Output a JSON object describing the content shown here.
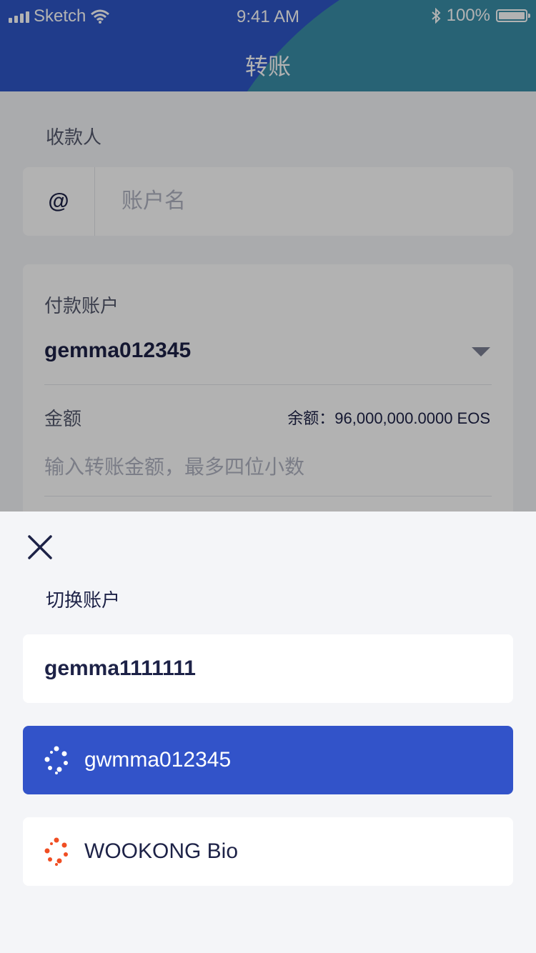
{
  "status_bar": {
    "carrier": "Sketch",
    "time": "9:41 AM",
    "battery": "100%"
  },
  "header": {
    "title": "转账"
  },
  "form": {
    "payee_label": "收款人",
    "payee_prefix": "@",
    "payee_placeholder": "账户名",
    "pay_account_label": "付款账户",
    "pay_account_value": "gemma012345",
    "amount_label": "金额",
    "balance_text": "余额：96,000,000.0000 EOS",
    "amount_placeholder": "输入转账金额，最多四位小数"
  },
  "sheet": {
    "title": "切换账户",
    "accounts": [
      {
        "name": "gemma1111111",
        "icon": null
      },
      {
        "name": "gwmma012345",
        "icon": "wookong-logo-icon",
        "selected": true
      },
      {
        "name": "WOOKONG Bio",
        "icon": "wookong-bio-logo-icon"
      }
    ]
  },
  "colors": {
    "primary": "#3253c9",
    "header_accent": "#3a8fa8",
    "text_dark": "#1d2247",
    "bio_orange": "#f04e23"
  }
}
